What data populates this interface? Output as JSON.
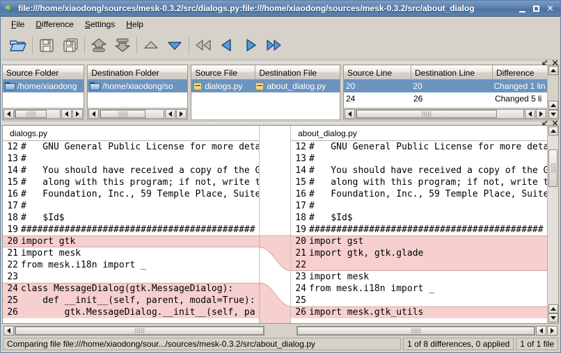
{
  "window": {
    "title": "file:///home/xiaodong/sources/mesk-0.3.2/src/dialogs.py:file:///home/xiaodong/sources/mesk-0.3.2/src/about_dialog",
    "icon": "app-icon",
    "minimize_label": "–",
    "maximize_label": "□",
    "close_label": "✕"
  },
  "menubar": {
    "items": [
      {
        "mnemonic": "F",
        "rest": "ile"
      },
      {
        "mnemonic": "D",
        "rest": "ifference"
      },
      {
        "mnemonic": "S",
        "rest": "ettings"
      },
      {
        "mnemonic": "H",
        "rest": "elp"
      }
    ]
  },
  "toolbar": {
    "buttons": [
      {
        "name": "open-icon",
        "tooltip": "Open",
        "enabled": true
      },
      {
        "name": "save-icon",
        "tooltip": "Save",
        "enabled": false
      },
      {
        "name": "save-as-icon",
        "tooltip": "Save As",
        "enabled": false
      },
      {
        "name": "apply-up-icon",
        "tooltip": "Apply Up",
        "enabled": false
      },
      {
        "name": "apply-down-icon",
        "tooltip": "Apply Down",
        "enabled": false
      },
      {
        "name": "previous-file-icon",
        "tooltip": "Previous File",
        "enabled": false
      },
      {
        "name": "next-file-icon",
        "tooltip": "Next File",
        "enabled": true
      },
      {
        "name": "first-difference-icon",
        "tooltip": "First Difference",
        "enabled": false
      },
      {
        "name": "previous-difference-icon",
        "tooltip": "Previous Difference",
        "enabled": true
      },
      {
        "name": "next-difference-icon",
        "tooltip": "Next Difference",
        "enabled": true
      },
      {
        "name": "last-difference-icon",
        "tooltip": "Last Difference",
        "enabled": true
      }
    ]
  },
  "panels": {
    "detach_icon": "detach-icon",
    "close_icon": "close-icon"
  },
  "source_folder_list": {
    "header": "Source Folder",
    "rows": [
      {
        "icon": "folder-icon",
        "label": "/home/xiaodong"
      }
    ]
  },
  "destination_folder_list": {
    "header": "Destination Folder",
    "rows": [
      {
        "icon": "folder-icon",
        "label": "/home/xiaodong/so"
      }
    ]
  },
  "files_list": {
    "headers": [
      "Source File",
      "Destination File"
    ],
    "rows": [
      {
        "source_icon": "python-file-icon",
        "source": "dialogs.py",
        "destination_icon": "python-file-icon",
        "destination": "about_dialog.py"
      }
    ]
  },
  "lines_list": {
    "headers": [
      "Source Line",
      "Destination Line",
      "Difference"
    ],
    "rows": [
      {
        "source_line": "20",
        "destination_line": "20",
        "difference": "Changed 1 lin",
        "selected": true
      },
      {
        "source_line": "24",
        "destination_line": "26",
        "difference": "Changed 5 li",
        "selected": false
      }
    ]
  },
  "source_pane": {
    "title": "dialogs.py",
    "lines": [
      {
        "num": "12",
        "text": "#   GNU General Public License for more deta",
        "diff": false
      },
      {
        "num": "13",
        "text": "#",
        "diff": false
      },
      {
        "num": "14",
        "text": "#   You should have received a copy of the G",
        "diff": false
      },
      {
        "num": "15",
        "text": "#   along with this program; if not, write t",
        "diff": false
      },
      {
        "num": "16",
        "text": "#   Foundation, Inc., 59 Temple Place, Suite",
        "diff": false
      },
      {
        "num": "17",
        "text": "#",
        "diff": false
      },
      {
        "num": "18",
        "text": "#   $Id$",
        "diff": false
      },
      {
        "num": "19",
        "text": "###########################################",
        "diff": false
      },
      {
        "num": "20",
        "text": "import gtk",
        "diff": true,
        "edge": "both"
      },
      {
        "num": "21",
        "text": "import mesk",
        "diff": false
      },
      {
        "num": "22",
        "text": "from mesk.i18n import _",
        "diff": false
      },
      {
        "num": "23",
        "text": "",
        "diff": false
      },
      {
        "num": "24",
        "text": "class MessageDialog(gtk.MessageDialog):",
        "diff": true,
        "edge": "top"
      },
      {
        "num": "25",
        "text": "    def __init__(self, parent, modal=True):",
        "diff": true,
        "edge": "none"
      },
      {
        "num": "26",
        "text": "        gtk.MessageDialog.__init__(self, pa",
        "diff": true,
        "edge": "none"
      }
    ]
  },
  "destination_pane": {
    "title": "about_dialog.py",
    "lines": [
      {
        "num": "12",
        "text": "#   GNU General Public License for more deta",
        "diff": false
      },
      {
        "num": "13",
        "text": "#",
        "diff": false
      },
      {
        "num": "14",
        "text": "#   You should have received a copy of the G",
        "diff": false
      },
      {
        "num": "15",
        "text": "#   along with this program; if not, write t",
        "diff": false
      },
      {
        "num": "16",
        "text": "#   Foundation, Inc., 59 Temple Place, Suite",
        "diff": false
      },
      {
        "num": "17",
        "text": "#",
        "diff": false
      },
      {
        "num": "18",
        "text": "#   $Id$",
        "diff": false
      },
      {
        "num": "19",
        "text": "###########################################",
        "diff": false
      },
      {
        "num": "20",
        "text": "import gst",
        "diff": true,
        "edge": "top"
      },
      {
        "num": "21",
        "text": "import gtk, gtk.glade",
        "diff": true,
        "edge": "none"
      },
      {
        "num": "22",
        "text": "",
        "diff": true,
        "edge": "bottom"
      },
      {
        "num": "23",
        "text": "import mesk",
        "diff": false
      },
      {
        "num": "24",
        "text": "from mesk.i18n import _",
        "diff": false
      },
      {
        "num": "25",
        "text": "",
        "diff": false
      },
      {
        "num": "26",
        "text": "import mesk.gtk_utils",
        "diff": true,
        "edge": "top"
      }
    ]
  },
  "statusbar": {
    "message": "Comparing file file:///home/xiaodong/sour.../sources/mesk-0.3.2/src/about_dialog.py",
    "differences": "1 of 8 differences, 0 applied",
    "files": "1 of 1 file"
  },
  "colors": {
    "titlebar": "#5c80ae",
    "selection": "#6b94be",
    "diff_highlight": "#f6cfcf",
    "diff_border": "#d9a5a5",
    "chrome": "#d6d2ca"
  }
}
